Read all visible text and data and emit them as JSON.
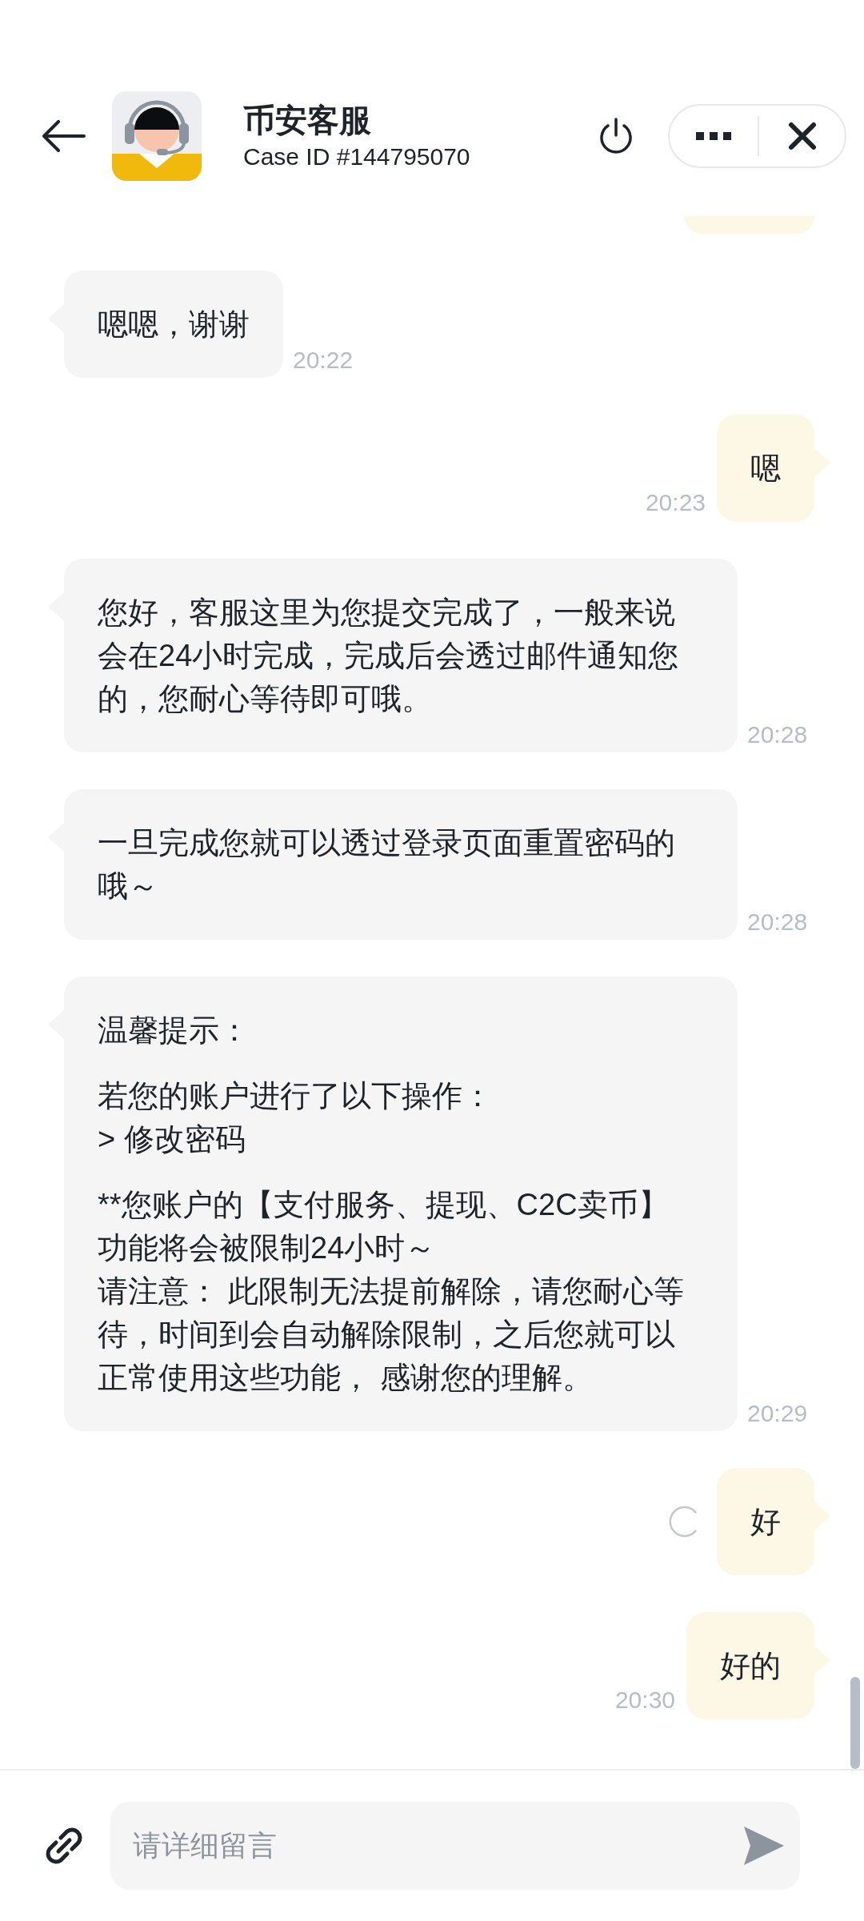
{
  "header": {
    "title": "币安客服",
    "subtitle": "Case ID #144795070"
  },
  "messages": [
    {
      "kind": "clipped",
      "pending": false
    },
    {
      "kind": "incoming",
      "paragraphs": [
        [
          "嗯嗯，谢谢"
        ]
      ],
      "time": "20:22",
      "pending": false
    },
    {
      "kind": "outgoing",
      "paragraphs": [
        [
          "嗯"
        ]
      ],
      "time": "20:23",
      "pending": false
    },
    {
      "kind": "incoming",
      "paragraphs": [
        [
          "您好，客服这里为您提交完成了，一般来说",
          "会在24小时完成，完成后会透过邮件通知您",
          "的，您耐心等待即可哦。"
        ]
      ],
      "time": "20:28",
      "pending": false
    },
    {
      "kind": "incoming",
      "paragraphs": [
        [
          "一旦完成您就可以透过登录页面重置密码的",
          "哦～"
        ]
      ],
      "time": "20:28",
      "pending": false
    },
    {
      "kind": "incoming",
      "paragraphs": [
        [
          "温馨提示："
        ],
        [
          "若您的账户进行了以下操作：",
          "> 修改密码"
        ],
        [
          "**您账户的【支付服务、提现、C2C卖币】",
          "功能将会被限制24小时～",
          "请注意： 此限制无法提前解除，请您耐心等",
          "待，时间到会自动解除限制，之后您就可以",
          "正常使用这些功能， 感谢您的理解。"
        ]
      ],
      "time": "20:29",
      "pending": false
    },
    {
      "kind": "outgoing",
      "paragraphs": [
        [
          "好"
        ]
      ],
      "pending": true
    },
    {
      "kind": "outgoing",
      "paragraphs": [
        [
          "好的"
        ]
      ],
      "time": "20:30",
      "pending": false
    }
  ],
  "composer": {
    "placeholder": "请详细留言"
  }
}
